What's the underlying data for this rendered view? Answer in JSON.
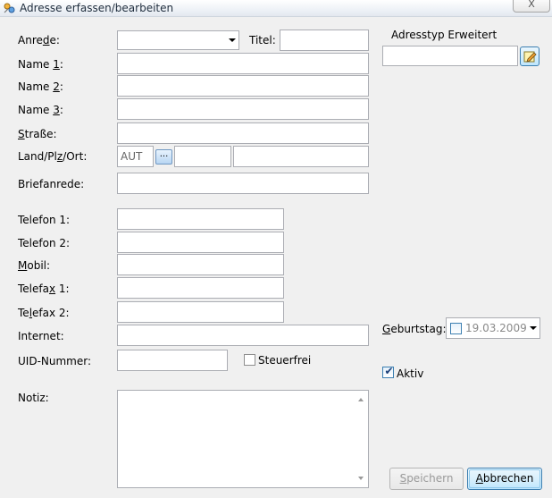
{
  "window": {
    "title": "Adresse erfassen/bearbeiten",
    "close_label": "X"
  },
  "form": {
    "anrede": {
      "label_pre": "Anre",
      "label_key": "d",
      "label_post": "e:",
      "value": ""
    },
    "titel": {
      "label": "Titel:",
      "value": ""
    },
    "name1": {
      "label_pre": "Name ",
      "label_key": "1",
      "label_post": ":",
      "value": ""
    },
    "name2": {
      "label_pre": "Name ",
      "label_key": "2",
      "label_post": ":",
      "value": ""
    },
    "name3": {
      "label_pre": "Name ",
      "label_key": "3",
      "label_post": ":",
      "value": ""
    },
    "strasse": {
      "label_pre": "",
      "label_key": "S",
      "label_post": "traße:",
      "value": ""
    },
    "land_plz_ort": {
      "label_pre": "Land/Pl",
      "label_key": "z",
      "label_post": "/Ort:",
      "land_value": "AUT",
      "browse_label": "...",
      "plz_value": "",
      "ort_value": ""
    },
    "briefanrede": {
      "label": "Briefanrede:",
      "value": ""
    },
    "telefon1": {
      "label": "Telefon 1:",
      "value": ""
    },
    "telefon2": {
      "label": "Telefon 2:",
      "value": ""
    },
    "mobil": {
      "label_pre": "",
      "label_key": "M",
      "label_post": "obil:",
      "value": ""
    },
    "telefax1": {
      "label_pre": "Telefa",
      "label_key": "x",
      "label_post": " 1:",
      "value": ""
    },
    "telefax2": {
      "label_pre": "Te",
      "label_key": "l",
      "label_post": "efax 2:",
      "value": ""
    },
    "internet": {
      "label": "Internet:",
      "value": ""
    },
    "uid": {
      "label": "UID-Nummer:",
      "value": ""
    },
    "steuerfrei": {
      "label": "Steuerfrei",
      "checked": false
    },
    "notiz": {
      "label": "Notiz:",
      "value": ""
    }
  },
  "right_panel": {
    "adresstyp_label": "Adresstyp Erweitert",
    "adresstyp_value": "",
    "edit_icon": "edit-note-icon",
    "geburtstag": {
      "label_pre": "",
      "label_key": "G",
      "label_post": "eburtstag:",
      "checked": false,
      "value": "19.03.2009"
    },
    "aktiv": {
      "label": "Aktiv",
      "checked": true
    }
  },
  "buttons": {
    "save_pre": "",
    "save_key": "S",
    "save_post": "peichern",
    "cancel_pre": "",
    "cancel_key": "A",
    "cancel_post": "bbrechen"
  },
  "colors": {
    "accent": "#3c7fb1",
    "field_border": "#abadb3",
    "background": "#f0f0f0"
  }
}
